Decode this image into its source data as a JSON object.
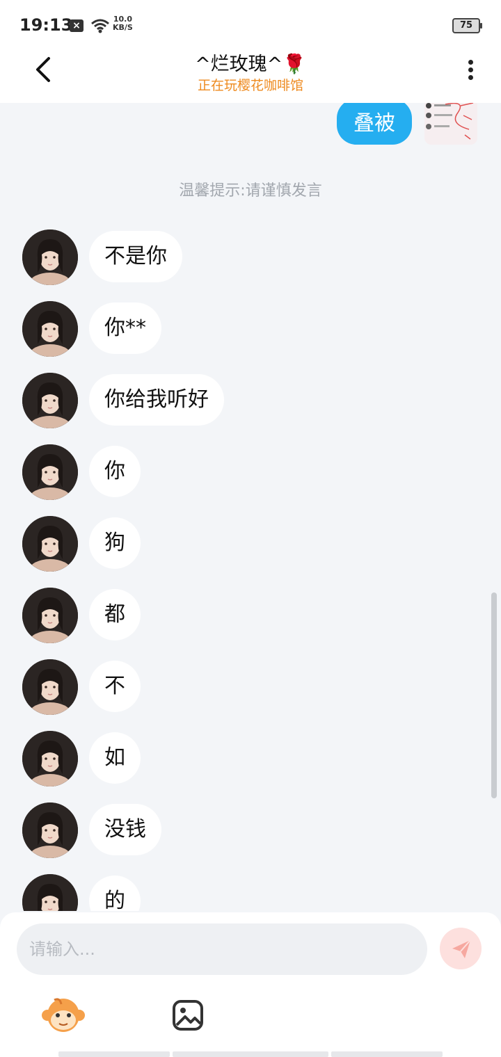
{
  "status_bar": {
    "time": "19:13",
    "net_speed_value": "10.0",
    "net_speed_unit": "KB/S",
    "battery": "75"
  },
  "header": {
    "title": "^烂玫瑰^🌹",
    "subtitle": "正在玩樱花咖啡馆"
  },
  "chat": {
    "outgoing": {
      "text": "叠被"
    },
    "tip": "温馨提示:请谨慎发言",
    "messages": [
      "不是你",
      "你**",
      "你给我听好",
      "你",
      "狗",
      "都",
      "不",
      "如",
      "没钱",
      "的"
    ]
  },
  "input": {
    "placeholder": "请输入..."
  },
  "colors": {
    "accent": "#25aef0",
    "subtitle": "#ee8a1f",
    "send_bg": "#fde0de",
    "background": "#f3f5f8"
  },
  "icons": {
    "back": "chevron-left-icon",
    "more": "vertical-dots-icon",
    "send": "paper-plane-icon",
    "emoji": "cartoon-monkey-icon",
    "image": "image-icon"
  }
}
